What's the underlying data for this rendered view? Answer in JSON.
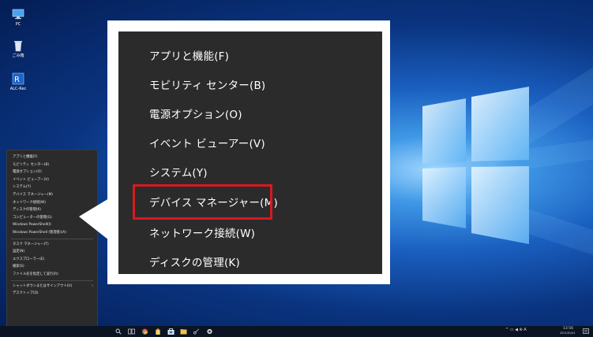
{
  "desktop": {
    "icons": [
      {
        "label": "PC",
        "icon": "pc-icon"
      },
      {
        "label": "ごみ箱",
        "icon": "recycle-bin-icon"
      },
      {
        "label": "ALC-Rec",
        "icon": "alc-rec-icon"
      }
    ]
  },
  "winx_menu": {
    "group1": [
      "アプリと機能(F)",
      "モビリティ センター(B)",
      "電源オプション(O)",
      "イベント ビューアー(V)",
      "システム(Y)",
      "デバイス マネージャー(M)",
      "ネットワーク接続(W)",
      "ディスクの管理(K)",
      "コンピューターの管理(G)",
      "Windows PowerShell(I)",
      "Windows PowerShell (管理者)(A)"
    ],
    "group2": [
      "タスク マネージャー(T)",
      "設定(N)",
      "エクスプローラー(E)",
      "検索(S)",
      "ファイル名を指定して実行(R)"
    ],
    "group3": [
      "シャットダウンまたはサインアウト(U)",
      "デスクトップ(D)"
    ]
  },
  "zoom_menu": {
    "items": [
      "アプリと機能(F)",
      "モビリティ センター(B)",
      "電源オプション(O)",
      "イベント ビューアー(V)",
      "システム(Y)",
      "デバイス マネージャー(M)",
      "ネットワーク接続(W)",
      "ディスクの管理(K)"
    ],
    "highlighted": "デバイス マネージャー(M)"
  },
  "taskbar": {
    "tray_text": "^ ▭ ◀ ⊕ A",
    "time": "13:56",
    "date": "2021/01/01"
  },
  "colors": {
    "menu_bg": "#2b2b2b",
    "highlight_border": "#d71920",
    "taskbar_bg": "#0b1423"
  }
}
